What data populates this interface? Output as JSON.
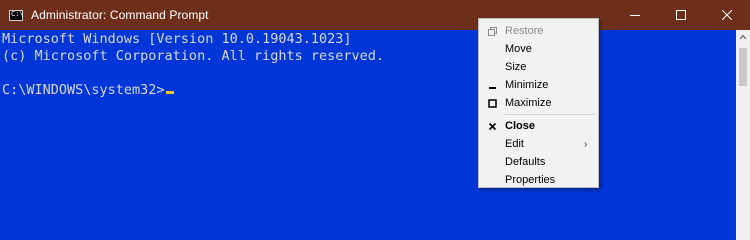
{
  "window": {
    "title": "Administrator: Command Prompt",
    "titlebar_color": "#6e2f1a",
    "console_bg": "#0036d8",
    "console_fg": "#d8d8d8",
    "cursor_color": "#f0c21b"
  },
  "console": {
    "lines": [
      "Microsoft Windows [Version 10.0.19043.1023]",
      "(c) Microsoft Corporation. All rights reserved.",
      "",
      "C:\\WINDOWS\\system32>"
    ]
  },
  "system_menu": {
    "items": [
      {
        "label": "Restore",
        "icon": "restore-icon",
        "disabled": true
      },
      {
        "label": "Move",
        "icon": "",
        "disabled": false
      },
      {
        "label": "Size",
        "icon": "",
        "disabled": false
      },
      {
        "label": "Minimize",
        "icon": "minimize-icon",
        "disabled": false
      },
      {
        "label": "Maximize",
        "icon": "maximize-icon",
        "disabled": false
      },
      {
        "label": "Close",
        "icon": "close-icon",
        "bold": true
      },
      {
        "label": "Edit",
        "icon": "",
        "submenu": true
      },
      {
        "label": "Defaults",
        "icon": ""
      },
      {
        "label": "Properties",
        "icon": ""
      }
    ]
  }
}
